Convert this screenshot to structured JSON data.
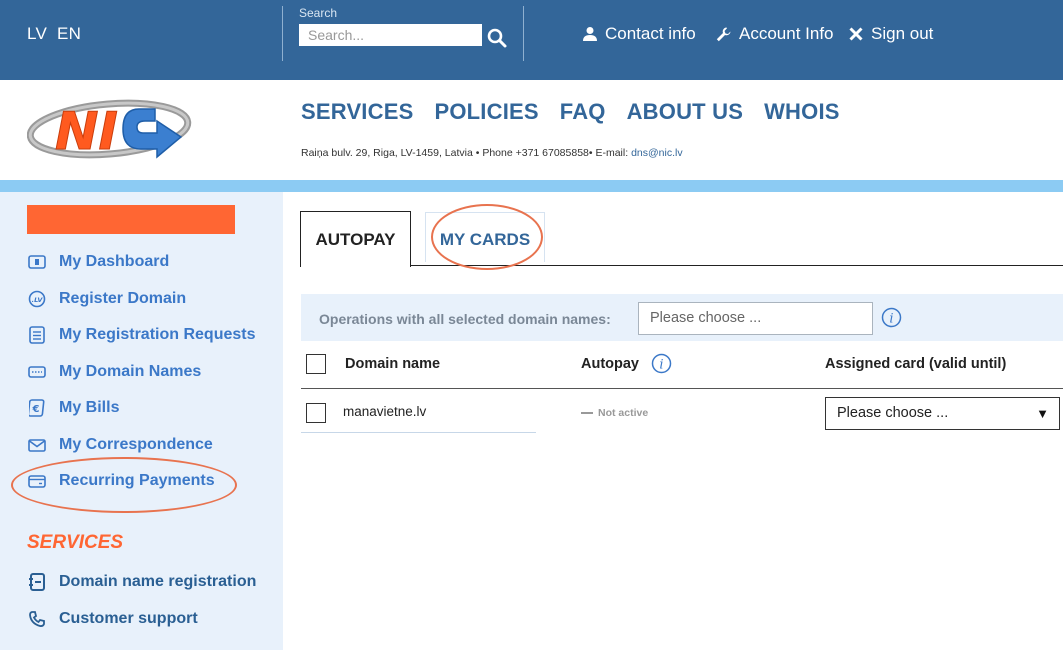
{
  "topbar": {
    "lang_lv": "LV",
    "lang_en": "EN",
    "search_label": "Search",
    "search_placeholder": "Search...",
    "contact": "Contact info",
    "account": "Account Info",
    "signout": "Sign out",
    "bg_color": "#336699"
  },
  "header": {
    "logo_text": "NIC",
    "nav": [
      "SERVICES",
      "POLICIES",
      "FAQ",
      "ABOUT US",
      "WHOIS"
    ],
    "address": "Raiņa bulv. 29, Riga, LV-1459, Latvia • Phone +371 67085858• E-mail: ",
    "email": "dns@nic.lv"
  },
  "sidebar": {
    "items": [
      {
        "label": "My Dashboard",
        "icon": "dashboard-icon"
      },
      {
        "label": "Register Domain",
        "icon": "lv-badge-icon"
      },
      {
        "label": "My Registration Requests",
        "icon": "list-icon"
      },
      {
        "label": "My Domain Names",
        "icon": "keyboard-icon"
      },
      {
        "label": "My Bills",
        "icon": "euro-bill-icon"
      },
      {
        "label": "My Correspondence",
        "icon": "envelope-icon"
      },
      {
        "label": "Recurring Payments",
        "icon": "wallet-icon"
      }
    ],
    "services_heading": "SERVICES",
    "services": [
      {
        "label": "Domain name registration",
        "icon": "registration-icon"
      },
      {
        "label": "Customer support",
        "icon": "phone-icon"
      }
    ],
    "accent_color": "#ff6633"
  },
  "tabs": {
    "autopay": "AUTOPAY",
    "mycards": "MY CARDS"
  },
  "operations": {
    "label": "Operations with all selected domain names:",
    "select_value": "Please choose ..."
  },
  "table": {
    "headers": {
      "domain": "Domain name",
      "autopay": "Autopay",
      "card": "Assigned card (valid until)"
    },
    "rows": [
      {
        "domain": "manavietne.lv",
        "autopay": "Not active",
        "card": "Please choose ..."
      }
    ]
  }
}
